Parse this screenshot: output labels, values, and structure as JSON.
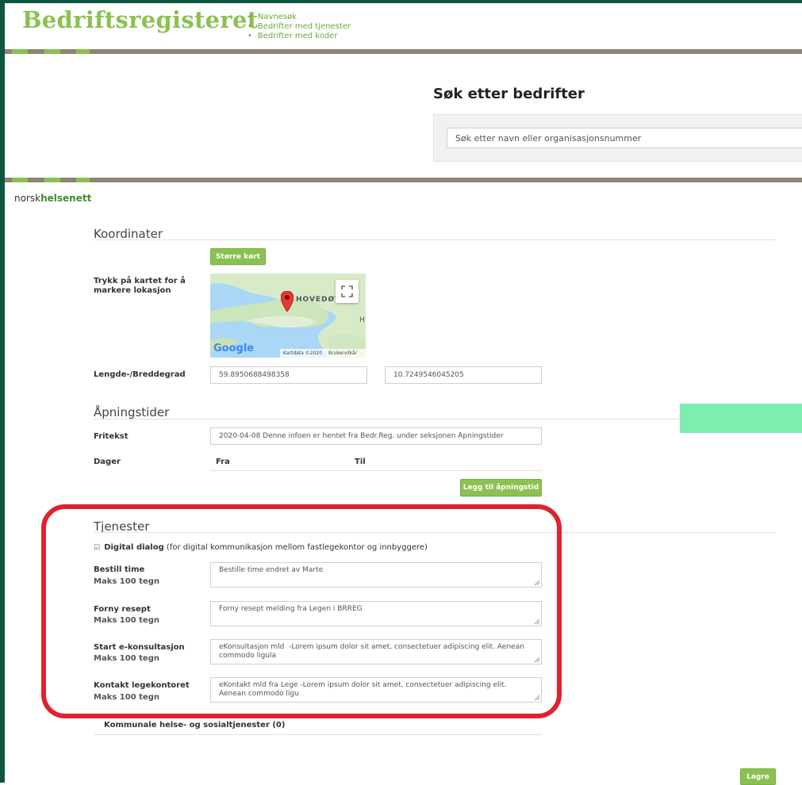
{
  "header": {
    "logo": "Bedriftsregisteret",
    "nav": [
      "Navnesøk",
      "Bedrifter med tjenester",
      "Bedrifter med koder"
    ]
  },
  "search": {
    "title": "Søk etter bedrifter",
    "placeholder": "Søk etter navn eller organisasjonsnummer"
  },
  "brand": {
    "prefix": "norsk",
    "emphasis": "helsenett"
  },
  "koordinater": {
    "title": "Koordinater",
    "bigger_map_button": "Større kart",
    "map_instruction": "Trykk på kartet for å markere lokasjon",
    "map": {
      "place_label": "HOVEDØYA",
      "edge_label": "H",
      "google_logo": "Google",
      "map_data": "Kartdata ©2020",
      "terms": "Brukervilkår"
    },
    "latlng_label": "Lengde-/Breddegrad",
    "lat": "59.8950688498358",
    "lng": "10.7249546045205"
  },
  "apningstider": {
    "title": "Åpningstider",
    "fritekst_label": "Fritekst",
    "fritekst_value": "2020-04-08 Denne infoen er hentet fra Bedr.Reg. under seksjonen Åpningstider",
    "dager_label": "Dager",
    "fra_label": "Fra",
    "til_label": "Til",
    "add_button": "Legg til åpningstid"
  },
  "tjenester": {
    "title": "Tjenester",
    "digital_dialog": {
      "checked": true,
      "label": "Digital dialog",
      "description": "(for digital kommunikasjon mellom fastlegekontor og innbyggere)"
    },
    "fields": [
      {
        "label": "Bestill time",
        "limit": "Maks 100 tegn",
        "value": "Bestille time endret av Marte"
      },
      {
        "label": "Forny resept",
        "limit": "Maks 100 tegn",
        "value": "Forny resept melding fra Legen i BRREG"
      },
      {
        "label": "Start e-konsultasjon",
        "limit": "Maks 100 tegn",
        "value": "eKonsultasjon mld  -Lorem ipsum dolor sit amet, consectetuer adipiscing elit. Aenean commodo ligula"
      },
      {
        "label": "Kontakt legekontoret",
        "limit": "Maks 100 tegn",
        "value": "eKontakt mld fra Lege -Lorem ipsum dolor sit amet, consectetuer adipiscing elit. Aenean commodo ligu"
      }
    ]
  },
  "kommunale": {
    "label": "Kommunale helse- og sosialtjenester (0)"
  },
  "save_button": "Lagre",
  "colors": {
    "brand_green": "#8cc152",
    "dark_green": "#0e5641",
    "band_gray": "#8c8573",
    "highlight_red": "#e0222e",
    "mint": "#7deeb0"
  }
}
